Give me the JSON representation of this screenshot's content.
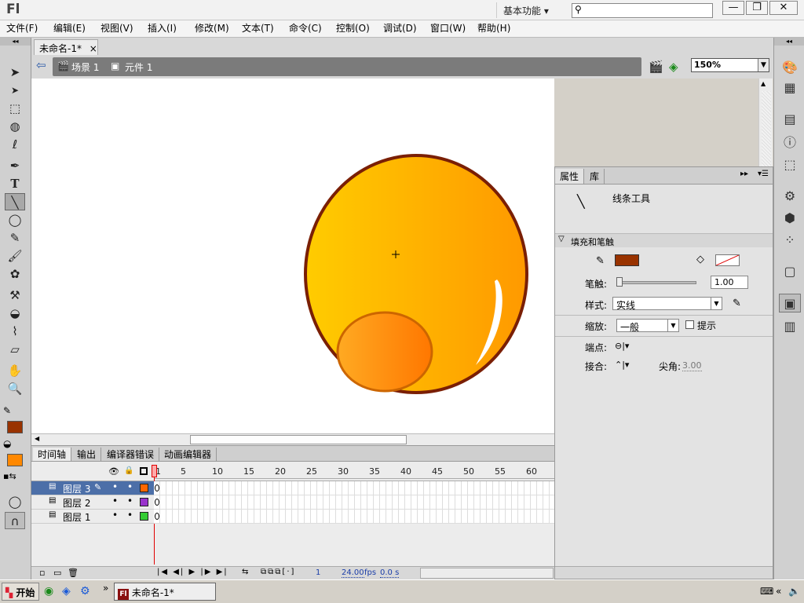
{
  "app": {
    "logo": "Fl",
    "workspace": "基本功能",
    "window_buttons": [
      "—",
      "❐",
      "✕"
    ]
  },
  "menu": [
    "文件(F)",
    "编辑(E)",
    "视图(V)",
    "插入(I)",
    "修改(M)",
    "文本(T)",
    "命令(C)",
    "控制(O)",
    "调试(D)",
    "窗口(W)",
    "帮助(H)"
  ],
  "doc_tab": {
    "title": "未命名-1*",
    "close": "×"
  },
  "edit_bar": {
    "scene": "场景 1",
    "symbol": "元件 1",
    "zoom": "150%"
  },
  "properties": {
    "tabs": [
      "属性",
      "库"
    ],
    "tool_name": "线条工具",
    "section_fill_stroke": "填充和笔触",
    "stroke_color": "#993300",
    "stroke_label": "笔触:",
    "stroke_value": "1.00",
    "style_label": "样式:",
    "style_value": "实线",
    "scale_label": "缩放:",
    "scale_value": "一般",
    "hint_label": "提示",
    "cap_label": "端点:",
    "join_label": "接合:",
    "miter_label": "尖角:",
    "miter_value": "3.00"
  },
  "timeline": {
    "tabs": [
      "时间轴",
      "输出",
      "编译器错误",
      "动画编辑器"
    ],
    "ruler": [
      "1",
      "5",
      "10",
      "15",
      "20",
      "25",
      "30",
      "35",
      "40",
      "45",
      "50",
      "55",
      "60"
    ],
    "layers": [
      {
        "name": "图层 3",
        "color": "#ff6600",
        "selected": true
      },
      {
        "name": "图层 2",
        "color": "#9933cc",
        "selected": false
      },
      {
        "name": "图层 1",
        "color": "#33cc33",
        "selected": false
      }
    ],
    "status": {
      "frame": "1",
      "fps": "24.00",
      "fps_unit": "fps",
      "time": "0.0 s"
    }
  },
  "toolbox": {
    "stroke_color": "#993300",
    "fill_color": "#ff8800"
  },
  "taskbar": {
    "start": "开始",
    "item": "未命名-1*",
    "more": "»"
  }
}
